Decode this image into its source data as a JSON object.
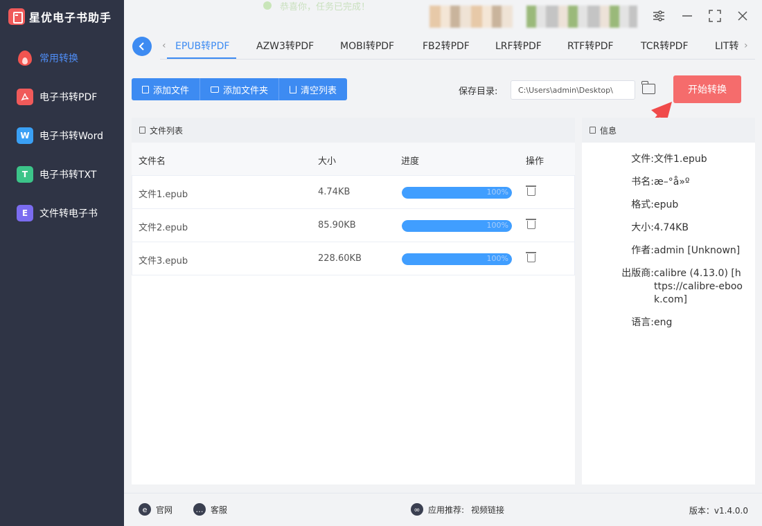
{
  "app": {
    "title": "星优电子书助手"
  },
  "toast": "恭喜你，任务已完成！",
  "sidebar": {
    "items": [
      {
        "label": "常用转换",
        "icon": "flame-icon",
        "active": true
      },
      {
        "label": "电子书转PDF",
        "icon": "pdf-icon",
        "glyph": "",
        "color": "#f05a5a"
      },
      {
        "label": "电子书转Word",
        "icon": "word-icon",
        "glyph": "W",
        "color": "#3aa0f5"
      },
      {
        "label": "电子书转TXT",
        "icon": "txt-icon",
        "glyph": "T",
        "color": "#3cc489"
      },
      {
        "label": "文件转电子书",
        "icon": "ebook-icon",
        "glyph": "E",
        "color": "#7b6cf0"
      }
    ]
  },
  "tabs": [
    {
      "label": "EPUB转PDF",
      "active": true
    },
    {
      "label": "AZW3转PDF"
    },
    {
      "label": "MOBI转PDF"
    },
    {
      "label": "FB2转PDF"
    },
    {
      "label": "LRF转PDF"
    },
    {
      "label": "RTF转PDF"
    },
    {
      "label": "TCR转PDF"
    },
    {
      "label": "LIT转"
    }
  ],
  "toolbar": {
    "add_file": "添加文件",
    "add_folder": "添加文件夹",
    "clear_list": "清空列表",
    "save_dir_label": "保存目录:",
    "save_dir_value": "C:\\Users\\admin\\Desktop\\",
    "start": "开始转换"
  },
  "file_list": {
    "title": "文件列表",
    "columns": {
      "name": "文件名",
      "size": "大小",
      "progress": "进度",
      "action": "操作"
    },
    "rows": [
      {
        "name": "文件1.epub",
        "size": "4.74KB",
        "progress": "100%",
        "progress_value": 100
      },
      {
        "name": "文件2.epub",
        "size": "85.90KB",
        "progress": "100%",
        "progress_value": 100
      },
      {
        "name": "文件3.epub",
        "size": "228.60KB",
        "progress": "100%",
        "progress_value": 100
      }
    ]
  },
  "info": {
    "title": "信息",
    "rows": [
      {
        "k": "文件:",
        "v": "文件1.epub"
      },
      {
        "k": "书名:",
        "v": "æ–°å»º"
      },
      {
        "k": "格式:",
        "v": "epub"
      },
      {
        "k": "大小:",
        "v": "4.74KB"
      },
      {
        "k": "作者:",
        "v": "admin [Unknown]"
      },
      {
        "k": "出版商:",
        "v": "calibre (4.13.0) [https://calibre-ebook.com]"
      },
      {
        "k": "语言:",
        "v": "eng"
      }
    ]
  },
  "footer": {
    "website": "官网",
    "service": "客服",
    "recommend_label": "应用推荐:",
    "recommend_link": "视频链接",
    "version": "版本：v1.4.0.0"
  }
}
